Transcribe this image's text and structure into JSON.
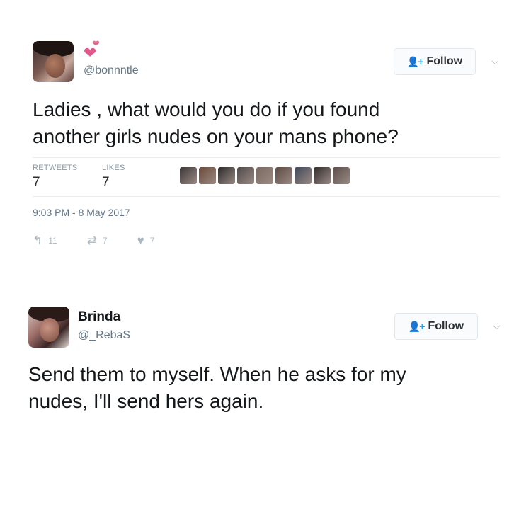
{
  "tweet1": {
    "handle": "@bonnntle",
    "follow_label": "Follow",
    "text_line1": "Ladies , what would you do if you found",
    "text_line2": "another girls nudes on your mans phone?",
    "retweets_label": "RETWEETS",
    "retweets_count": "7",
    "likes_label": "LIKES",
    "likes_count": "7",
    "timestamp": "9:03 PM - 8 May 2017",
    "reply_count": "11",
    "retweet_count": "7",
    "like_count": "7",
    "liker_colors": [
      "#3a3636",
      "#6b4a3a",
      "#2a2a2a",
      "#4f4a4a",
      "#7a6a60",
      "#5d4b42",
      "#3f4758",
      "#2f2b2b",
      "#5a4d49"
    ]
  },
  "tweet2": {
    "display_name": "Brinda",
    "handle": "@_RebaS",
    "follow_label": "Follow",
    "text_line1": "Send them to myself. When he asks for my",
    "text_line2": "nudes, I'll send hers again."
  },
  "colors": {
    "accent": "#1da1f2",
    "heart": "#e0598b",
    "muted": "#657786"
  }
}
